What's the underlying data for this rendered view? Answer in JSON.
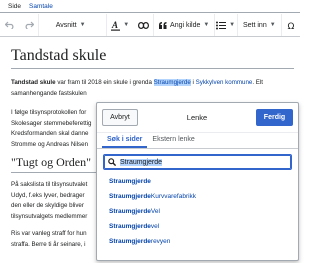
{
  "tabs": [
    {
      "label": "Side"
    },
    {
      "label": "Samtale"
    }
  ],
  "toolbar": {
    "format_label": "Avsnitt",
    "cite_label": "Angi kilde",
    "insert_label": "Sett inn"
  },
  "page": {
    "title": "Tandstad skule",
    "para1": {
      "bold": "Tandstad skule",
      "text1": " var fram til 2018 ein skule i grenda ",
      "selected": "Straumgjerde",
      "text2": " i ",
      "link": "Sykkylven kommune",
      "text3": ". Elt"
    },
    "para1_line2": "samanhengande fastskulen",
    "para2_lines": [
      "I følge tilsynsprotokollen for",
      "Skolesager stemmebeferettig",
      "Kredsformanden skal danne",
      "Stromme og Andreas Nilsen"
    ],
    "section": "\"Tugt og Orden\"",
    "para3_lines": [
      "På sakslista til tilsynsutvalet",
      "Udyd, f.eks lyver, bedrager",
      "den eller de skyldige bliver",
      "tilsynsutvalgets medlemmer"
    ],
    "para4_lines": [
      "Ris var vanleg straff for hun",
      "straffa. Berre ti år seinare, i"
    ]
  },
  "link_dialog": {
    "cancel_label": "Avbryt",
    "title": "Lenke",
    "done_label": "Ferdig",
    "tabs": [
      {
        "label": "Søk i sider"
      },
      {
        "label": "Ekstern lenke"
      }
    ],
    "search_value": "Straumgjerde",
    "results": [
      {
        "bold": "Straumgjerde",
        "rest": ""
      },
      {
        "bold": "Straumgjerde",
        "rest": " Kurvvarefabrikk"
      },
      {
        "bold": "Straumgjerde",
        "rest": " Vel"
      },
      {
        "bold": "Straumgjerde",
        "rest": " vel"
      },
      {
        "bold": "Straumgjerde",
        "rest": "revyen"
      }
    ]
  },
  "colors": {
    "accent": "#3366cc",
    "link": "#0645ad",
    "selection": "#b3d4fc"
  }
}
